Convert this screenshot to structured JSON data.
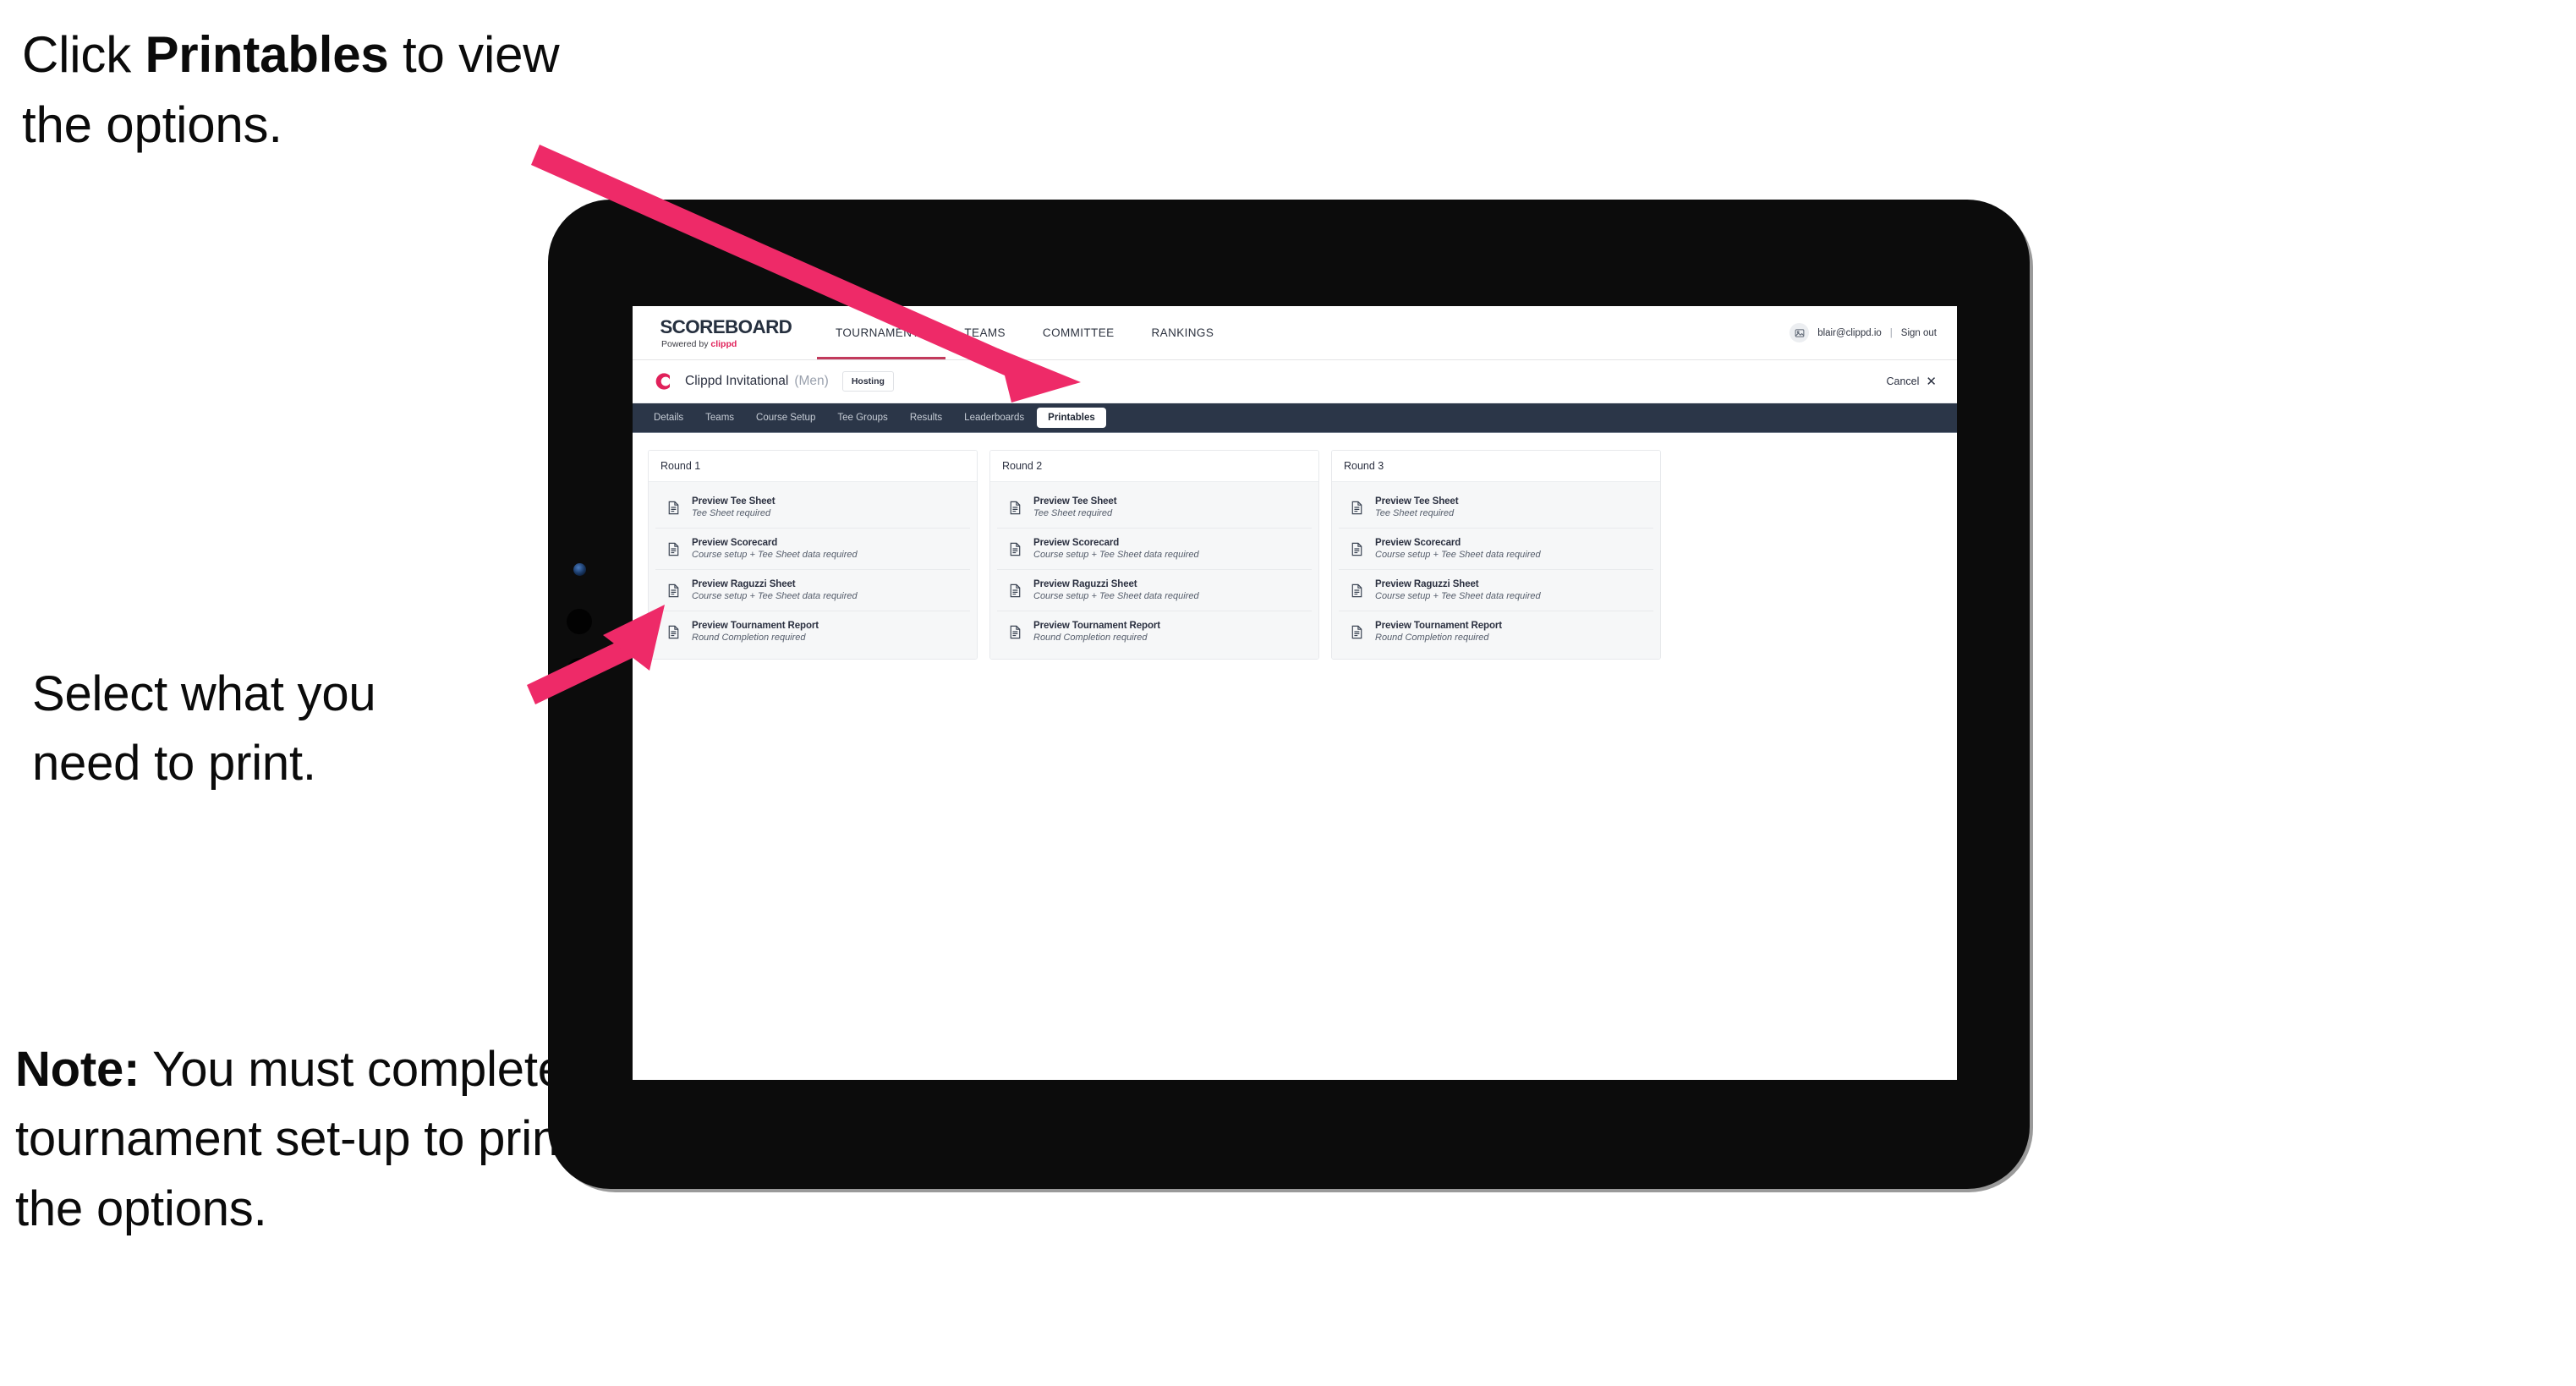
{
  "annotations": {
    "click_prefix": "Click ",
    "click_bold": "Printables",
    "click_suffix": " to view the options.",
    "select": "Select what you need you print.",
    "select_line1": "Select what you",
    "select_line2": " need to print.",
    "note_bold": "Note:",
    "note_rest": " You must complete the tournament set-up to print all the options."
  },
  "app": {
    "brand": {
      "name": "SCOREBOARD",
      "powered_prefix": "Powered by ",
      "powered_brand": "clippd"
    },
    "main_nav": [
      {
        "label": "TOURNAMENTS",
        "active": true
      },
      {
        "label": "TEAMS",
        "active": false
      },
      {
        "label": "COMMITTEE",
        "active": false
      },
      {
        "label": "RANKINGS",
        "active": false
      }
    ],
    "account": {
      "email": "blair@clippd.io",
      "separator": "|",
      "sign_out": "Sign out"
    },
    "tournament": {
      "title": "Clippd Invitational",
      "gender": "(Men)",
      "status_badge": "Hosting",
      "cancel_label": "Cancel"
    },
    "section_nav": [
      {
        "label": "Details",
        "selected": false
      },
      {
        "label": "Teams",
        "selected": false
      },
      {
        "label": "Course Setup",
        "selected": false
      },
      {
        "label": "Tee Groups",
        "selected": false
      },
      {
        "label": "Results",
        "selected": false
      },
      {
        "label": "Leaderboards",
        "selected": false
      },
      {
        "label": "Printables",
        "selected": true
      }
    ],
    "rounds": [
      {
        "heading": "Round 1",
        "items": [
          {
            "title": "Preview Tee Sheet",
            "requirement": "Tee Sheet required"
          },
          {
            "title": "Preview Scorecard",
            "requirement": "Course setup + Tee Sheet data required"
          },
          {
            "title": "Preview Raguzzi Sheet",
            "requirement": "Course setup + Tee Sheet data required"
          },
          {
            "title": "Preview Tournament Report",
            "requirement": "Round Completion required"
          }
        ]
      },
      {
        "heading": "Round 2",
        "items": [
          {
            "title": "Preview Tee Sheet",
            "requirement": "Tee Sheet required"
          },
          {
            "title": "Preview Scorecard",
            "requirement": "Course setup + Tee Sheet data required"
          },
          {
            "title": "Preview Raguzzi Sheet",
            "requirement": "Course setup + Tee Sheet data required"
          },
          {
            "title": "Preview Tournament Report",
            "requirement": "Round Completion required"
          }
        ]
      },
      {
        "heading": "Round 3",
        "items": [
          {
            "title": "Preview Tee Sheet",
            "requirement": "Tee Sheet required"
          },
          {
            "title": "Preview Scorecard",
            "requirement": "Course setup + Tee Sheet data required"
          },
          {
            "title": "Preview Raguzzi Sheet",
            "requirement": "Course setup + Tee Sheet data required"
          },
          {
            "title": "Preview Tournament Report",
            "requirement": "Round Completion required"
          }
        ]
      }
    ]
  },
  "colors": {
    "accent_pink": "#ee2a68",
    "brand_crimson": "#e0215a",
    "nav_underline": "#c23a5c",
    "section_nav_bg": "#2b3648",
    "device_body": "#0c0c0c"
  }
}
